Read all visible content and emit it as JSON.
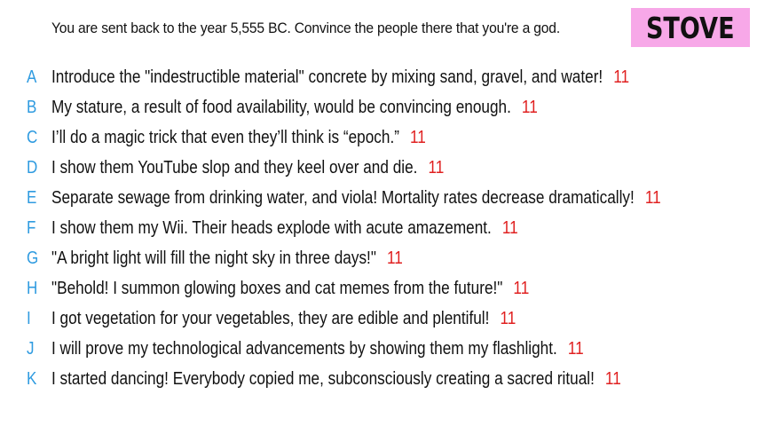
{
  "prompt": "You are sent back to the year 5,555 BC. Convince the people there that you're a god.",
  "badge": {
    "label": "STOVE",
    "background": "#f7a8e8"
  },
  "colors": {
    "letter": "#2f9be0",
    "score": "#e02020"
  },
  "answers": [
    {
      "letter": "A",
      "text": "Introduce the \"indestructible material\" concrete by mixing sand, gravel, and water!",
      "score": "11"
    },
    {
      "letter": "B",
      "text": "My stature, a result of food availability, would be convincing enough.",
      "score": "11"
    },
    {
      "letter": "C",
      "text": "I’ll do a magic trick that even they’ll think is “epoch.”",
      "score": "11"
    },
    {
      "letter": "D",
      "text": "I show them YouTube slop and they keel over and die.",
      "score": "11"
    },
    {
      "letter": "E",
      "text": "Separate sewage from drinking water, and viola! Mortality rates decrease dramatically!",
      "score": "11"
    },
    {
      "letter": "F",
      "text": "I show them my Wii. Their heads explode with acute amazement.",
      "score": "11"
    },
    {
      "letter": "G",
      "text": "\"A bright light will fill the night sky in three days!\"",
      "score": "11"
    },
    {
      "letter": "H",
      "text": "\"Behold! I summon glowing boxes and cat memes from the future!\"",
      "score": "11"
    },
    {
      "letter": "I",
      "text": "I got vegetation for your vegetables, they are edible and plentiful!",
      "score": "11"
    },
    {
      "letter": "J",
      "text": "I will prove my technological advancements by showing them my flashlight.",
      "score": "11"
    },
    {
      "letter": "K",
      "text": "I started dancing! Everybody copied me, subconsciously creating a sacred ritual!",
      "score": "11"
    }
  ]
}
